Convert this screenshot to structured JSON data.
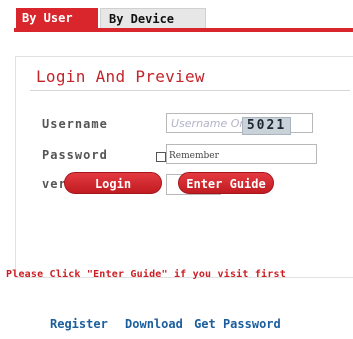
{
  "tabs": {
    "by_user": "By User",
    "by_device": "By Device"
  },
  "login": {
    "title": "Login And Preview",
    "username_label": "Username",
    "username_placeholder": "Username Or E-Mail",
    "password_label": "Password",
    "verify_label": "verify",
    "captcha_code": "5021",
    "remember_label": "Remember",
    "login_button": "Login",
    "guide_button": "Enter Guide",
    "notice": "Please Click \"Enter Guide\" if you visit first"
  },
  "footer": {
    "register": "Register",
    "download": "Download",
    "get_password": "Get Password"
  },
  "colors": {
    "accent": "#d8262c",
    "link": "#1b5e9e"
  }
}
